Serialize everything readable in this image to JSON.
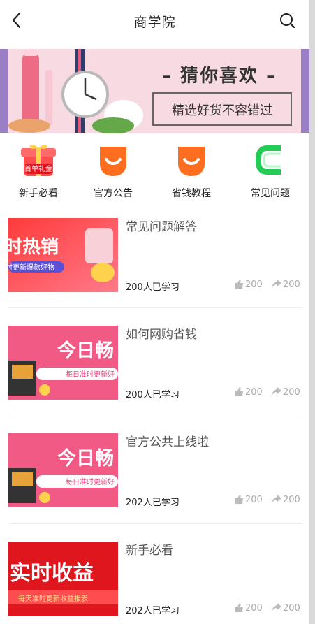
{
  "header": {
    "title": "商学院",
    "back_icon": "chevron-left-icon",
    "search_icon": "search-icon"
  },
  "banner": {
    "title": "– 猜你喜欢 –",
    "subtitle": "精选好货不容错过"
  },
  "quick_links": [
    {
      "label": "新手必看",
      "icon": "gift-icon",
      "badge": "首单礼金"
    },
    {
      "label": "官方公告",
      "icon": "smile-shop-icon"
    },
    {
      "label": "省钱教程",
      "icon": "smile-shop-icon"
    },
    {
      "label": "常见问题",
      "icon": "c-logo-icon"
    }
  ],
  "articles": [
    {
      "title": "常见问题解答",
      "learned": "200人已学习",
      "likes": "200",
      "shares": "200",
      "thumb": {
        "big": "时热销",
        "small": "时更新爆款好物"
      }
    },
    {
      "title": "如何网购省钱",
      "learned": "200人已学习",
      "likes": "200",
      "shares": "200",
      "thumb": {
        "big": "今日畅",
        "small": "每日准时更新好"
      }
    },
    {
      "title": "官方公共上线啦",
      "learned": "202人已学习",
      "likes": "200",
      "shares": "200",
      "thumb": {
        "big": "今日畅",
        "small": "每日准时更新好"
      }
    },
    {
      "title": "新手必看",
      "learned": "202人已学习",
      "likes": "200",
      "shares": "200",
      "thumb": {
        "big": "实时收益",
        "small": "每天准时更新收益报表"
      }
    }
  ],
  "colors": {
    "orange": "#ff6d1f",
    "green": "#22cc55",
    "pink_banner": "#f8dbe2",
    "purple_side": "#9b7fc6"
  }
}
